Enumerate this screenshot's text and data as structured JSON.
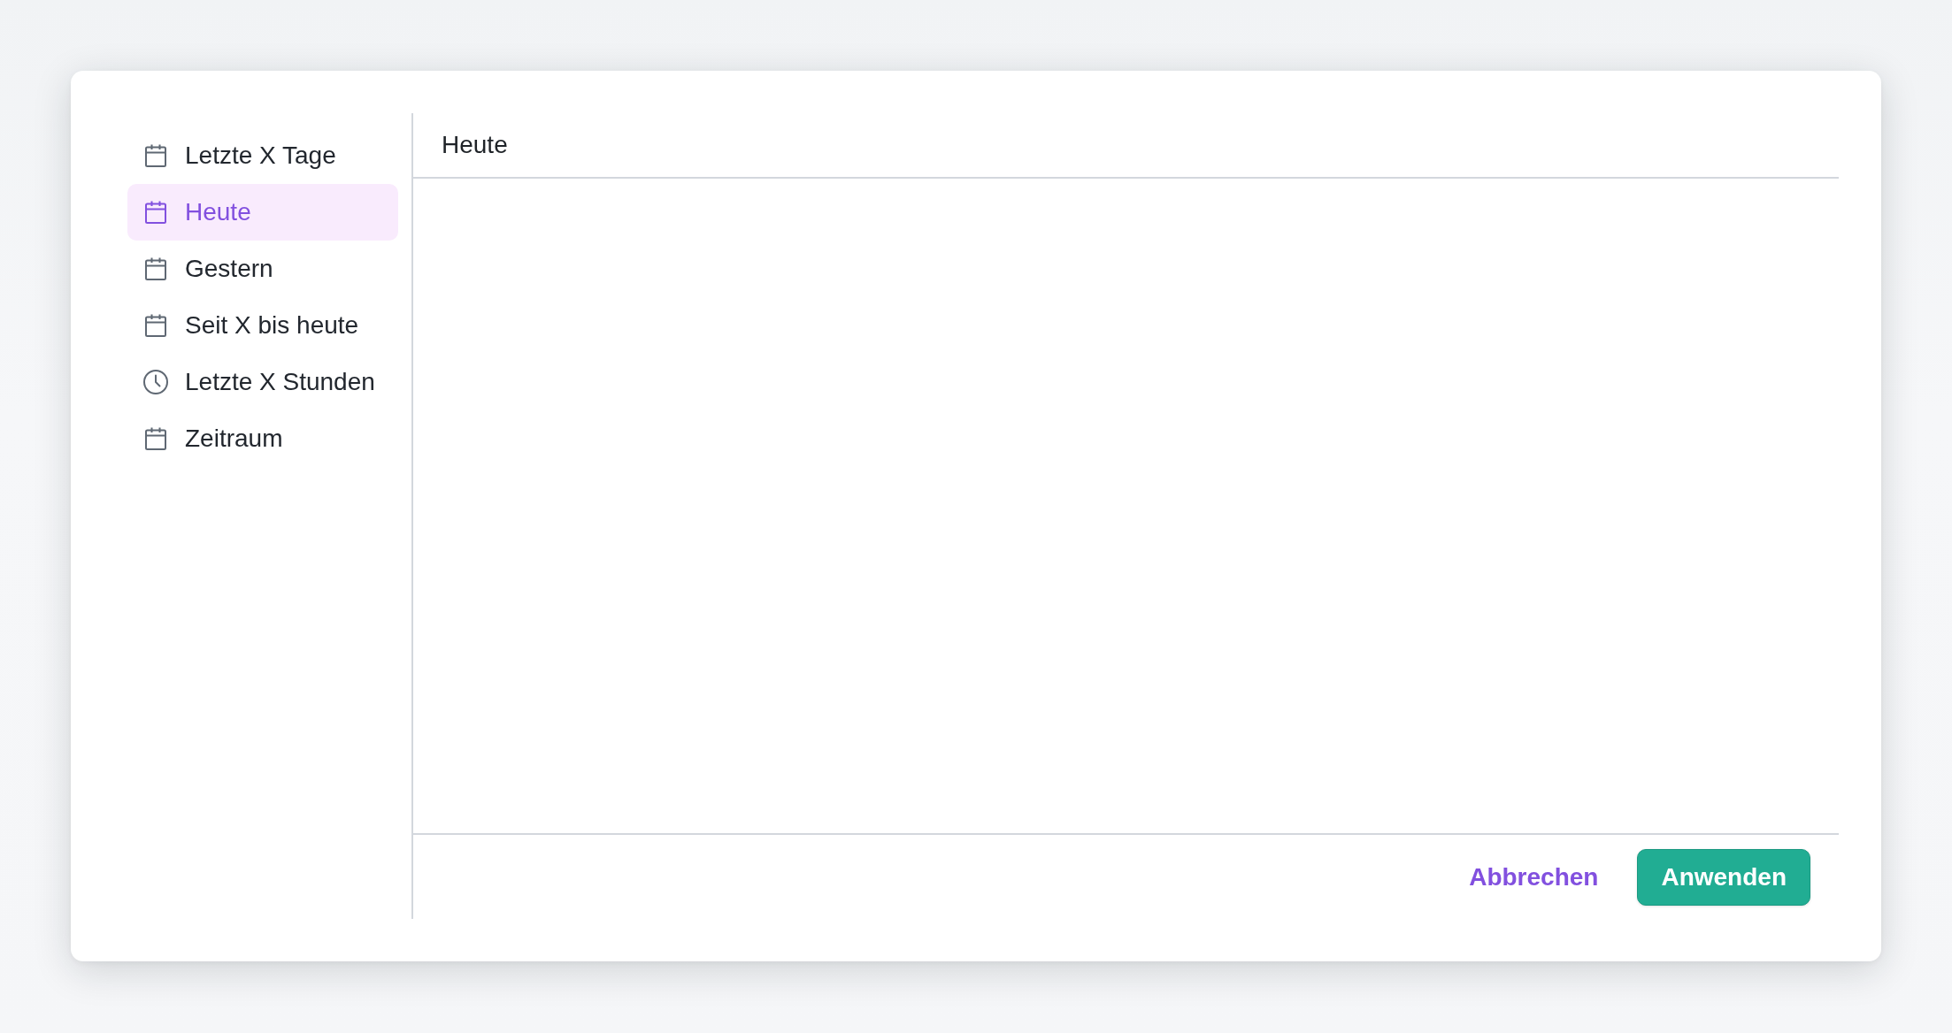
{
  "sidebar": {
    "items": [
      {
        "label": "Letzte X Tage",
        "kind": "date",
        "selected": false
      },
      {
        "label": "Heute",
        "kind": "date",
        "selected": true
      },
      {
        "label": "Gestern",
        "kind": "date",
        "selected": false
      },
      {
        "label": "Seit X bis heute",
        "kind": "date",
        "selected": false
      },
      {
        "label": "Letzte X Stunden",
        "kind": "time",
        "selected": false
      },
      {
        "label": "Zeitraum",
        "kind": "date",
        "selected": false
      }
    ]
  },
  "panel": {
    "title": "Heute"
  },
  "footer": {
    "buttons": [
      {
        "label": "Abbrechen",
        "kind": "secondary"
      },
      {
        "label": "Anwenden",
        "kind": "primary"
      }
    ]
  }
}
